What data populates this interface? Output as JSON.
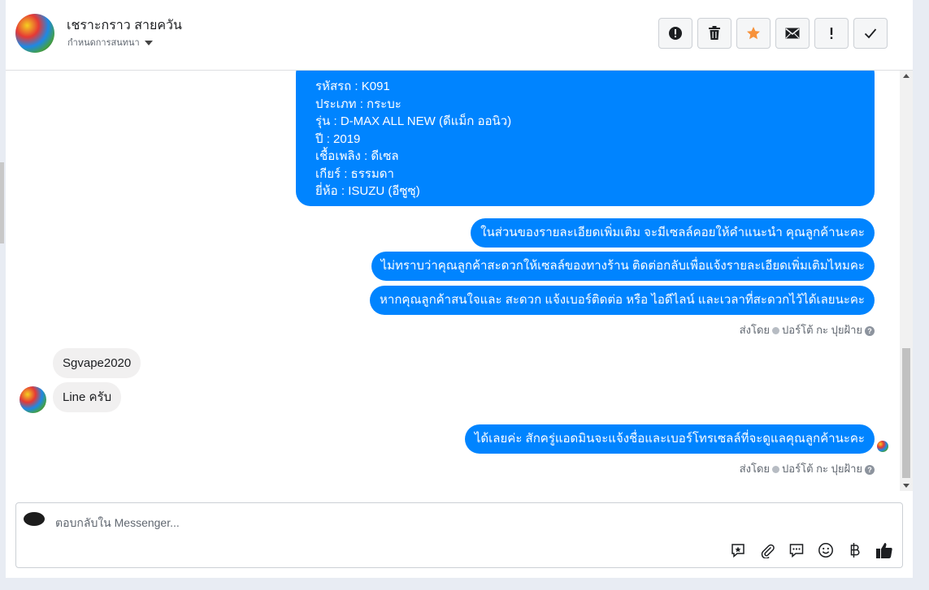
{
  "header": {
    "name": "เชราะกราว สายควัน",
    "assign_label": "กำหนดการสนทนา"
  },
  "toolbar": [
    {
      "name": "mark-spam-button",
      "icon": "exclamation-circle-icon"
    },
    {
      "name": "delete-button",
      "icon": "trash-icon"
    },
    {
      "name": "star-button",
      "icon": "star-icon"
    },
    {
      "name": "mark-unread-button",
      "icon": "envelope-icon"
    },
    {
      "name": "follow-up-button",
      "icon": "exclamation-icon"
    },
    {
      "name": "mark-done-button",
      "icon": "check-icon"
    }
  ],
  "vehicle": {
    "code": "รหัสรถ : K091",
    "type": "ประเภท : กระบะ",
    "model": "รุ่น : D-MAX ALL NEW (ดีแม็ก ออนิว)",
    "year": "ปี : 2019",
    "fuel": "เชื้อเพลิง : ดีเซล",
    "gear": "เกียร์ : ธรรมดา",
    "brand": "ยี่ห้อ : ISUZU (อีซูซุ)"
  },
  "messages": {
    "m1": "ในส่วนของรายละเอียดเพิ่มเติม จะมีเซลล์คอยให้คำแนะนำ คุณลูกค้านะคะ",
    "m2": "ไม่ทราบว่าคุณลูกค้าสะดวกให้เซลล์ของทางร้าน ติดต่อกลับเพื่อแจ้งรายละเอียดเพิ่มเติมไหมคะ",
    "m3": "หากคุณลูกค้าสนใจและ สะดวก แจ้งเบอร์ติดต่อ หรือ ไอดีไลน์ และเวลาที่สะดวกไว้ได้เลยนะคะ",
    "incoming1": "Sgvape2020",
    "incoming2": "Line ครับ",
    "m4": "ได้เลยค่ะ สักครู่แอดมินจะแจ้งชื่อและเบอร์โทรเซลล์ที่จะดูแลคุณลูกค้านะคะ"
  },
  "sent_by": {
    "prefix": "ส่งโดย",
    "sender": "ปอร์โต้ กะ ปุยฝ้าย"
  },
  "reply": {
    "placeholder": "ตอบกลับใน Messenger..."
  },
  "composer_tools": [
    "saved-reply-icon",
    "attachment-icon",
    "quick-reply-icon",
    "emoji-icon",
    "baht-icon",
    "like-icon"
  ],
  "colors": {
    "accent": "#0084ff",
    "star": "#f7923b"
  }
}
